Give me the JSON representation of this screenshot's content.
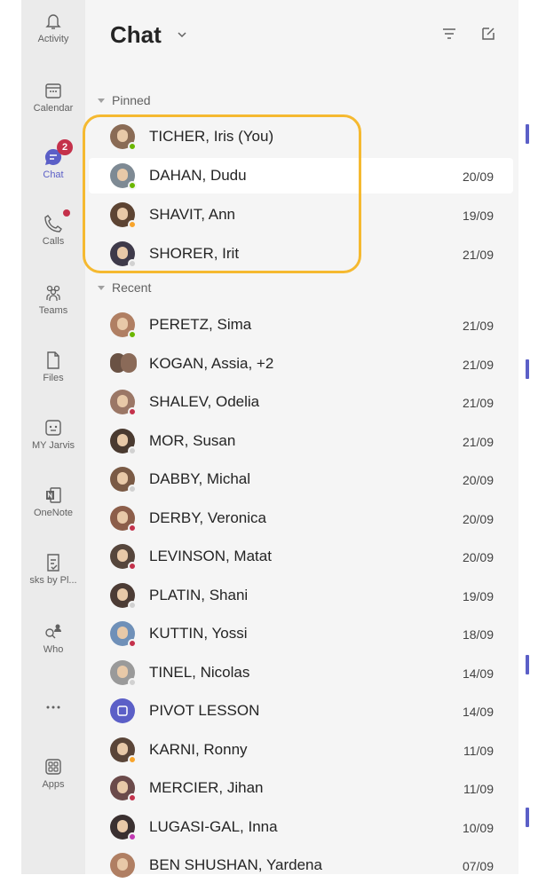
{
  "rail": {
    "items": [
      {
        "label": "Activity",
        "icon": "bell-icon"
      },
      {
        "label": "Calendar",
        "icon": "calendar-icon"
      },
      {
        "label": "Chat",
        "icon": "chat-icon",
        "badge": "2"
      },
      {
        "label": "Calls",
        "icon": "phone-icon"
      },
      {
        "label": "Teams",
        "icon": "teams-icon"
      },
      {
        "label": "Files",
        "icon": "file-icon"
      },
      {
        "label": "MY Jarvis",
        "icon": "jarvis-icon"
      },
      {
        "label": "OneNote",
        "icon": "onenote-icon"
      },
      {
        "label": "sks by Pl...",
        "icon": "tasks-icon"
      },
      {
        "label": "Who",
        "icon": "who-icon"
      },
      {
        "label": "...",
        "icon": "more-icon"
      },
      {
        "label": "Apps",
        "icon": "apps-icon"
      }
    ]
  },
  "header": {
    "title": "Chat"
  },
  "pinned": {
    "label": "Pinned",
    "rows": [
      {
        "name": "TICHER, Iris (You)",
        "date": "",
        "status": "#6bb700",
        "avatar": "#8a6b55"
      },
      {
        "name": "DAHAN, Dudu",
        "date": "20/09",
        "status": "#6bb700",
        "avatar": "#7e8a94"
      },
      {
        "name": "SHAVIT, Ann",
        "date": "19/09",
        "status": "#f8a42b",
        "avatar": "#5d4433"
      },
      {
        "name": "SHORER, Irit",
        "date": "21/09",
        "status": "#d1d1d1",
        "avatar": "#3e3a4a"
      }
    ]
  },
  "recent": {
    "label": "Recent",
    "rows": [
      {
        "name": "PERETZ, Sima",
        "date": "21/09",
        "status": "#6bb700",
        "avatar": "#b07f63"
      },
      {
        "name": "KOGAN, Assia, +2",
        "date": "21/09",
        "status": "",
        "avatar": "#6a5244"
      },
      {
        "name": "SHALEV, Odelia",
        "date": "21/09",
        "status": "#c4314b",
        "avatar": "#9b7766"
      },
      {
        "name": "MOR, Susan",
        "date": "21/09",
        "status": "#d1d1d1",
        "avatar": "#4a3a30"
      },
      {
        "name": "DABBY, Michal",
        "date": "20/09",
        "status": "#d1d1d1",
        "avatar": "#7a5a45"
      },
      {
        "name": "DERBY, Veronica",
        "date": "20/09",
        "status": "#c4314b",
        "avatar": "#8c5e4a"
      },
      {
        "name": "LEVINSON, Matat",
        "date": "20/09",
        "status": "#c4314b",
        "avatar": "#56463c"
      },
      {
        "name": "PLATIN, Shani",
        "date": "19/09",
        "status": "#d1d1d1",
        "avatar": "#4c3c35"
      },
      {
        "name": "KUTTIN, Yossi",
        "date": "18/09",
        "status": "#c4314b",
        "avatar": "#6f90b8"
      },
      {
        "name": "TINEL, Nicolas",
        "date": "14/09",
        "status": "#d1d1d1",
        "avatar": "#9a9a9a"
      },
      {
        "name": "PIVOT LESSON",
        "date": "14/09",
        "status": "",
        "avatar": "#5b5fc7"
      },
      {
        "name": "KARNI, Ronny",
        "date": "11/09",
        "status": "#f8a42b",
        "avatar": "#5a4538"
      },
      {
        "name": "MERCIER, Jihan",
        "date": "11/09",
        "status": "#c4314b",
        "avatar": "#6b4a4a"
      },
      {
        "name": "LUGASI-GAL, Inna",
        "date": "10/09",
        "status": "#c239b3",
        "avatar": "#3a3030"
      },
      {
        "name": "BEN SHUSHAN, Yardena",
        "date": "07/09",
        "status": "",
        "avatar": "#b07f63"
      }
    ]
  }
}
